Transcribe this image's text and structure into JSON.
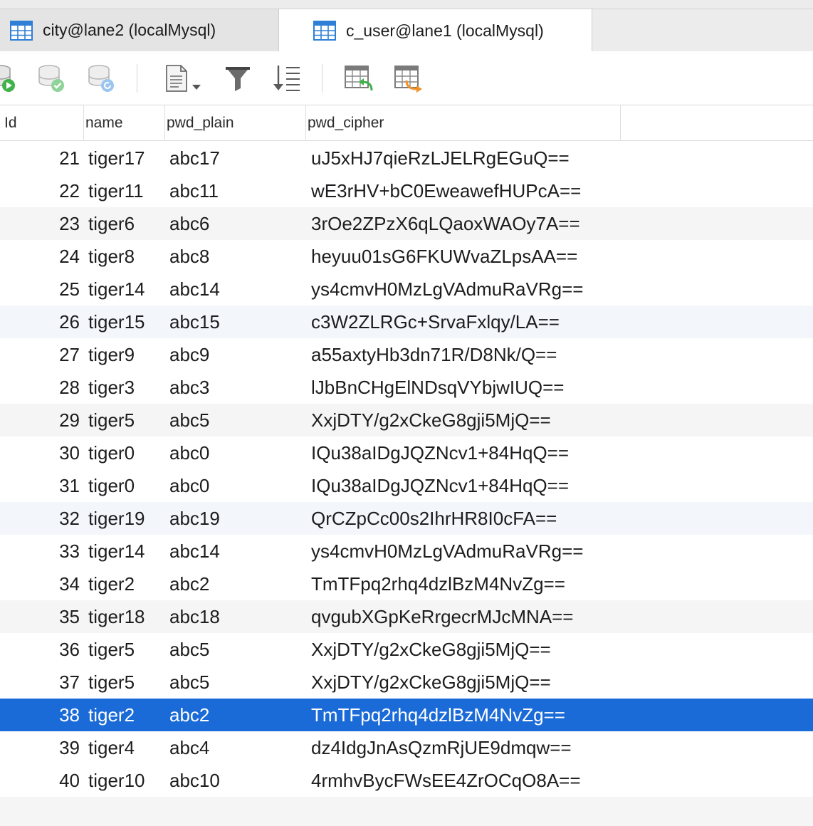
{
  "tabs": [
    {
      "label": "city@lane2 (localMysql)",
      "active": false
    },
    {
      "label": "c_user@lane1 (localMysql)",
      "active": true
    }
  ],
  "toolbar": {
    "buttons": [
      "run-icon",
      "commit-icon",
      "refresh-icon",
      "export-icon",
      "filter-icon",
      "sort-icon",
      "revert-table-icon",
      "save-table-icon"
    ]
  },
  "columns": [
    "Id",
    "name",
    "pwd_plain",
    "pwd_cipher"
  ],
  "rows": [
    {
      "id": "21",
      "name": "tiger17",
      "pwd_plain": "abc17",
      "pwd_cipher": "uJ5xHJ7qieRzLJELRgEGuQ=="
    },
    {
      "id": "22",
      "name": "tiger11",
      "pwd_plain": "abc11",
      "pwd_cipher": "wE3rHV+bC0EweawefHUPcA=="
    },
    {
      "id": "23",
      "name": "tiger6",
      "pwd_plain": "abc6",
      "pwd_cipher": "3rOe2ZPzX6qLQaoxWAOy7A=="
    },
    {
      "id": "24",
      "name": "tiger8",
      "pwd_plain": "abc8",
      "pwd_cipher": "heyuu01sG6FKUWvaZLpsAA=="
    },
    {
      "id": "25",
      "name": "tiger14",
      "pwd_plain": "abc14",
      "pwd_cipher": "ys4cmvH0MzLgVAdmuRaVRg=="
    },
    {
      "id": "26",
      "name": "tiger15",
      "pwd_plain": "abc15",
      "pwd_cipher": "c3W2ZLRGc+SrvaFxlqy/LA=="
    },
    {
      "id": "27",
      "name": "tiger9",
      "pwd_plain": "abc9",
      "pwd_cipher": "a55axtyHb3dn71R/D8Nk/Q=="
    },
    {
      "id": "28",
      "name": "tiger3",
      "pwd_plain": "abc3",
      "pwd_cipher": "lJbBnCHgElNDsqVYbjwIUQ=="
    },
    {
      "id": "29",
      "name": "tiger5",
      "pwd_plain": "abc5",
      "pwd_cipher": "XxjDTY/g2xCkeG8gji5MjQ=="
    },
    {
      "id": "30",
      "name": "tiger0",
      "pwd_plain": "abc0",
      "pwd_cipher": "IQu38aIDgJQZNcv1+84HqQ=="
    },
    {
      "id": "31",
      "name": "tiger0",
      "pwd_plain": "abc0",
      "pwd_cipher": "IQu38aIDgJQZNcv1+84HqQ=="
    },
    {
      "id": "32",
      "name": "tiger19",
      "pwd_plain": "abc19",
      "pwd_cipher": "QrCZpCc00s2IhrHR8I0cFA=="
    },
    {
      "id": "33",
      "name": "tiger14",
      "pwd_plain": "abc14",
      "pwd_cipher": "ys4cmvH0MzLgVAdmuRaVRg=="
    },
    {
      "id": "34",
      "name": "tiger2",
      "pwd_plain": "abc2",
      "pwd_cipher": "TmTFpq2rhq4dzlBzM4NvZg=="
    },
    {
      "id": "35",
      "name": "tiger18",
      "pwd_plain": "abc18",
      "pwd_cipher": "qvgubXGpKeRrgecrMJcMNA=="
    },
    {
      "id": "36",
      "name": "tiger5",
      "pwd_plain": "abc5",
      "pwd_cipher": "XxjDTY/g2xCkeG8gji5MjQ=="
    },
    {
      "id": "37",
      "name": "tiger5",
      "pwd_plain": "abc5",
      "pwd_cipher": "XxjDTY/g2xCkeG8gji5MjQ=="
    },
    {
      "id": "38",
      "name": "tiger2",
      "pwd_plain": "abc2",
      "pwd_cipher": "TmTFpq2rhq4dzlBzM4NvZg=="
    },
    {
      "id": "39",
      "name": "tiger4",
      "pwd_plain": "abc4",
      "pwd_cipher": "dz4IdgJnAsQzmRjUE9dmqw=="
    },
    {
      "id": "40",
      "name": "tiger10",
      "pwd_plain": "abc10",
      "pwd_cipher": "4rmhvBycFWsEE4ZrOCqO8A=="
    }
  ],
  "selected_row_id": "38",
  "colors": {
    "selection": "#1a6ad8",
    "row_alt": "#f5f5f5",
    "row_highlight": "#f3f7fc",
    "icon_blue": "#2f7fd6",
    "icon_green": "#3fb24a",
    "icon_orange": "#f0922b"
  }
}
